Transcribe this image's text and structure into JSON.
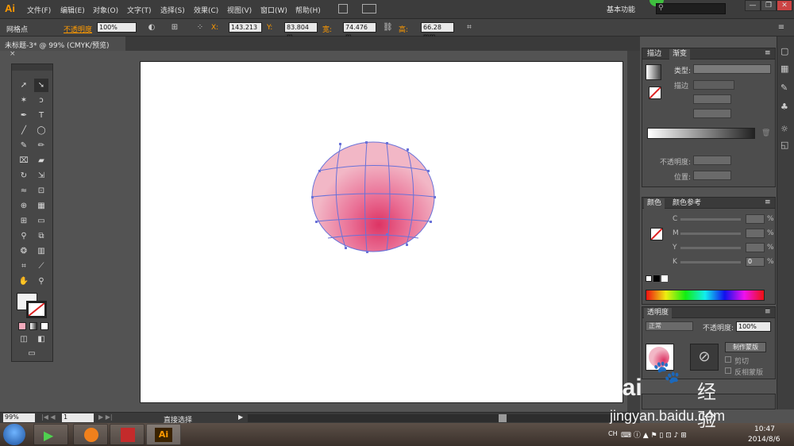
{
  "app": {
    "logo": "Ai"
  },
  "menu": [
    "文件(F)",
    "编辑(E)",
    "对象(O)",
    "文字(T)",
    "选择(S)",
    "效果(C)",
    "视图(V)",
    "窗口(W)",
    "帮助(H)"
  ],
  "workspace": {
    "label": "基本功能"
  },
  "window_buttons": [
    "—",
    "❐",
    "✕"
  ],
  "control": {
    "selection_label": "网格点",
    "opacity_label": "不透明度",
    "opacity_value": "100%",
    "x_label": "X:",
    "x_value": "143.213",
    "y_label": "Y:",
    "y_value": "83.804 m",
    "w_label": "宽:",
    "w_value": "74.476 m",
    "h_label": "高:",
    "h_value": "66.28 mm"
  },
  "document_tab": {
    "title": "未标题-3* @ 99% (CMYK/预览)",
    "close": "×"
  },
  "gradient_panel": {
    "tabs": [
      "描边",
      "渐变"
    ],
    "type_label": "类型:",
    "stroke_label": "描边",
    "opacity_label": "不透明度:",
    "position_label": "位置:"
  },
  "color_panel": {
    "tabs": [
      "颜色",
      "颜色参考"
    ],
    "channels": [
      {
        "name": "C",
        "value": "",
        "unit": "%"
      },
      {
        "name": "M",
        "value": "",
        "unit": "%"
      },
      {
        "name": "Y",
        "value": "",
        "unit": "%"
      },
      {
        "name": "K",
        "value": "0",
        "unit": "%"
      }
    ]
  },
  "transparency_panel": {
    "title": "透明度",
    "blend_mode": "正常",
    "opacity_label": "不透明度:",
    "opacity_value": "100%",
    "make_mask_button": "制作蒙版",
    "clip_label": "剪切",
    "invert_label": "反相蒙版"
  },
  "status": {
    "zoom": "99%",
    "page": "1",
    "tool_name": "直接选择"
  },
  "taskbar": {
    "lang": "CH",
    "time": "10:47",
    "date": "2014/8/6"
  },
  "watermark": {
    "brand": "Bai",
    "brand2": "经验",
    "url": "jingyan.baidu.com"
  },
  "colors": {
    "accent": "#ff9a00",
    "sphere_base": "#f2a9bb",
    "sphere_hot": "#e03a6e",
    "mesh": "#6670d8"
  }
}
